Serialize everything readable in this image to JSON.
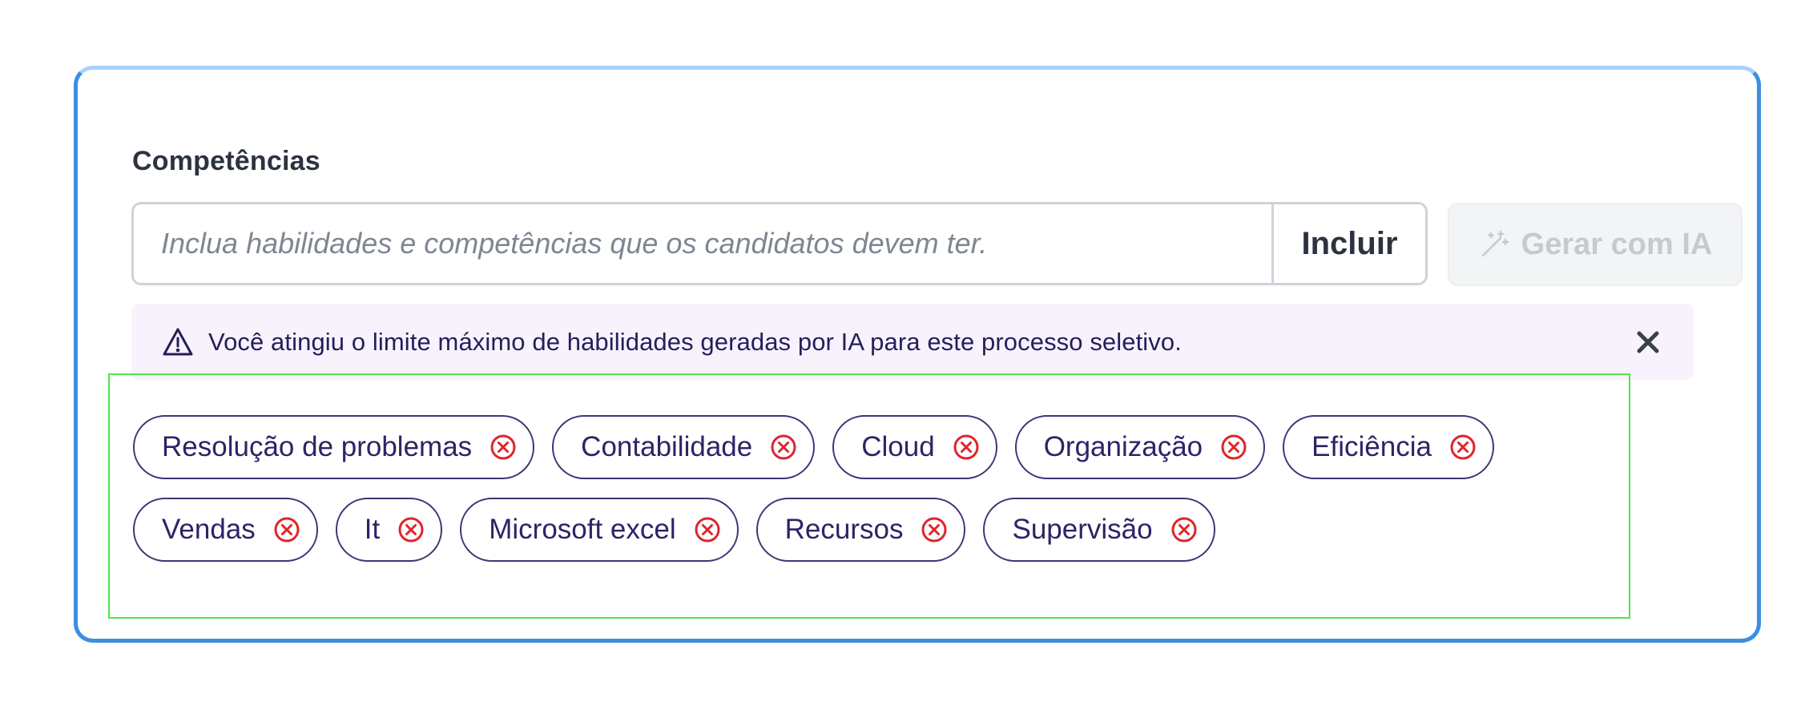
{
  "skills_section": {
    "label": "Competências",
    "input": {
      "placeholder": "Inclua habilidades e competências que os candidatos devem ter.",
      "value": ""
    },
    "include_label": "Incluir",
    "ai_label": "Gerar com IA",
    "alert": {
      "text": "Você atingiu o limite máximo de habilidades geradas por IA para este processo seletivo."
    },
    "tags_row1": [
      "Resolução de problemas",
      "Contabilidade",
      "Cloud",
      "Organização",
      "Eficiência"
    ],
    "tags_row2": [
      "Vendas",
      "It",
      "Microsoft excel",
      "Recursos",
      "Supervisão"
    ]
  },
  "colors": {
    "card_border": "#3b8fe0",
    "tag_border": "#3d3575",
    "remove_icon": "#e0242c",
    "alert_background": "#f8f2fd",
    "highlight_box": "#4de64d"
  },
  "icons": {
    "ai_button": "magic-wand-icon",
    "alert": "warning-triangle-icon",
    "alert_close": "close-icon",
    "tag_remove": "remove-circle-icon"
  }
}
